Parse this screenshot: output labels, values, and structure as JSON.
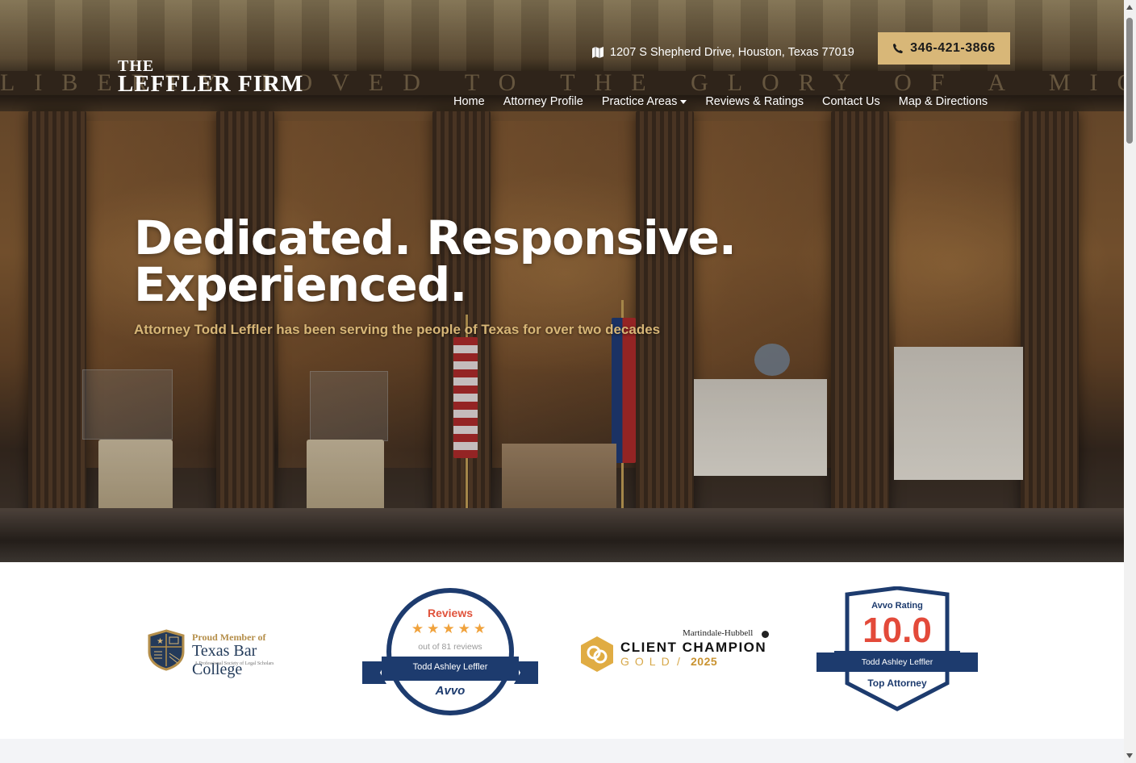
{
  "header": {
    "logo_line1": "THE",
    "logo_line2": "LEFFLER FIRM",
    "address": "1207 S Shepherd Drive, Houston, Texas 77019",
    "phone": "346-421-3866"
  },
  "nav": {
    "items": [
      {
        "label": "Home"
      },
      {
        "label": "Attorney Profile"
      },
      {
        "label": "Practice Areas"
      },
      {
        "label": "Reviews & Ratings"
      },
      {
        "label": "Contact Us"
      },
      {
        "label": "Map & Directions"
      }
    ]
  },
  "hero": {
    "frieze_text": "LIBERTY LOVED TO THE GLORY OF A MIGHTY HOUSTON",
    "headline_line1": "Dedicated. Responsive.",
    "headline_line2": "Experienced.",
    "tagline": "Attorney Todd Leffler has been serving the people of Texas for over two decades"
  },
  "badges": {
    "tbc": {
      "line1": "Proud Member of",
      "line2": "Texas Bar College",
      "line3": "A Professional Society of Legal Scholars"
    },
    "avvo_reviews": {
      "title": "Reviews",
      "stars": "★★★★★",
      "rating_stars": 5,
      "count": "out of 81 reviews",
      "name": "Todd Ashley Leffler",
      "brand": "Avvo"
    },
    "martindale": {
      "top": "Martindale-Hubbell",
      "main": "CLIENT CHAMPION",
      "tier": "GOLD",
      "separator": "/",
      "year": "2025"
    },
    "avvo_rating": {
      "label": "Avvo Rating",
      "score": "10.0",
      "name": "Todd Ashley Leffler",
      "title": "Top Attorney"
    }
  },
  "colors": {
    "accent_gold": "#d8b778",
    "tagline_gold": "#d7b677",
    "avvo_navy": "#1d3b6e",
    "avvo_red": "#e34a3a"
  }
}
